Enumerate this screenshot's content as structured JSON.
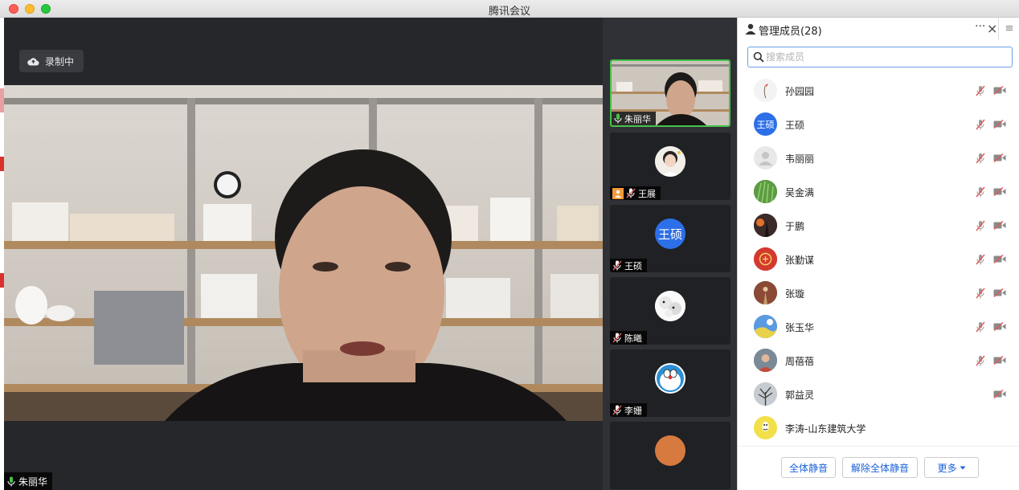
{
  "window": {
    "title": "腾讯会议"
  },
  "recording": {
    "label": "录制中"
  },
  "main_speaker": {
    "name": "朱丽华"
  },
  "thumbnails": [
    {
      "name": "朱丽华",
      "kind": "video",
      "active": true,
      "mic": "on"
    },
    {
      "name": "王展",
      "kind": "photo",
      "host": true,
      "mic": "off"
    },
    {
      "name": "王硕",
      "kind": "text",
      "avatar_text": "王硕",
      "mic": "off"
    },
    {
      "name": "陈曦",
      "kind": "photo",
      "mic": "off"
    },
    {
      "name": "李姗",
      "kind": "photo",
      "mic": "off"
    }
  ],
  "panel": {
    "title": "管理成员(28)",
    "more": "···",
    "close": "×",
    "menu": "≡",
    "search_placeholder": "搜索成员",
    "members": [
      {
        "name": "孙园园",
        "mic": "off",
        "cam": "off"
      },
      {
        "name": "王硕",
        "avatar_text": "王硕",
        "mic": "off",
        "cam": "off"
      },
      {
        "name": "韦丽丽",
        "mic": "off",
        "cam": "off"
      },
      {
        "name": "吴金满",
        "mic": "off",
        "cam": "off"
      },
      {
        "name": "于鹏",
        "mic": "off",
        "cam": "off"
      },
      {
        "name": "张勤谋",
        "mic": "off",
        "cam": "off"
      },
      {
        "name": "张璇",
        "mic": "off",
        "cam": "off"
      },
      {
        "name": "张玉华",
        "mic": "off",
        "cam": "off"
      },
      {
        "name": "周蓓蓓",
        "mic": "off",
        "cam": "off"
      },
      {
        "name": "郭益灵",
        "cam": "off"
      },
      {
        "name": "李涛-山东建筑大学"
      }
    ],
    "buttons": {
      "mute_all": "全体静音",
      "unmute_all": "解除全体静音",
      "more": "更多"
    }
  },
  "colors": {
    "accent": "#1a62d6",
    "active_border": "#46c14b",
    "avatar_blue": "#2d6fe8",
    "host_orange": "#f39a3a",
    "mic_on": "#46c14b",
    "muted_red": "#e05a5a"
  }
}
